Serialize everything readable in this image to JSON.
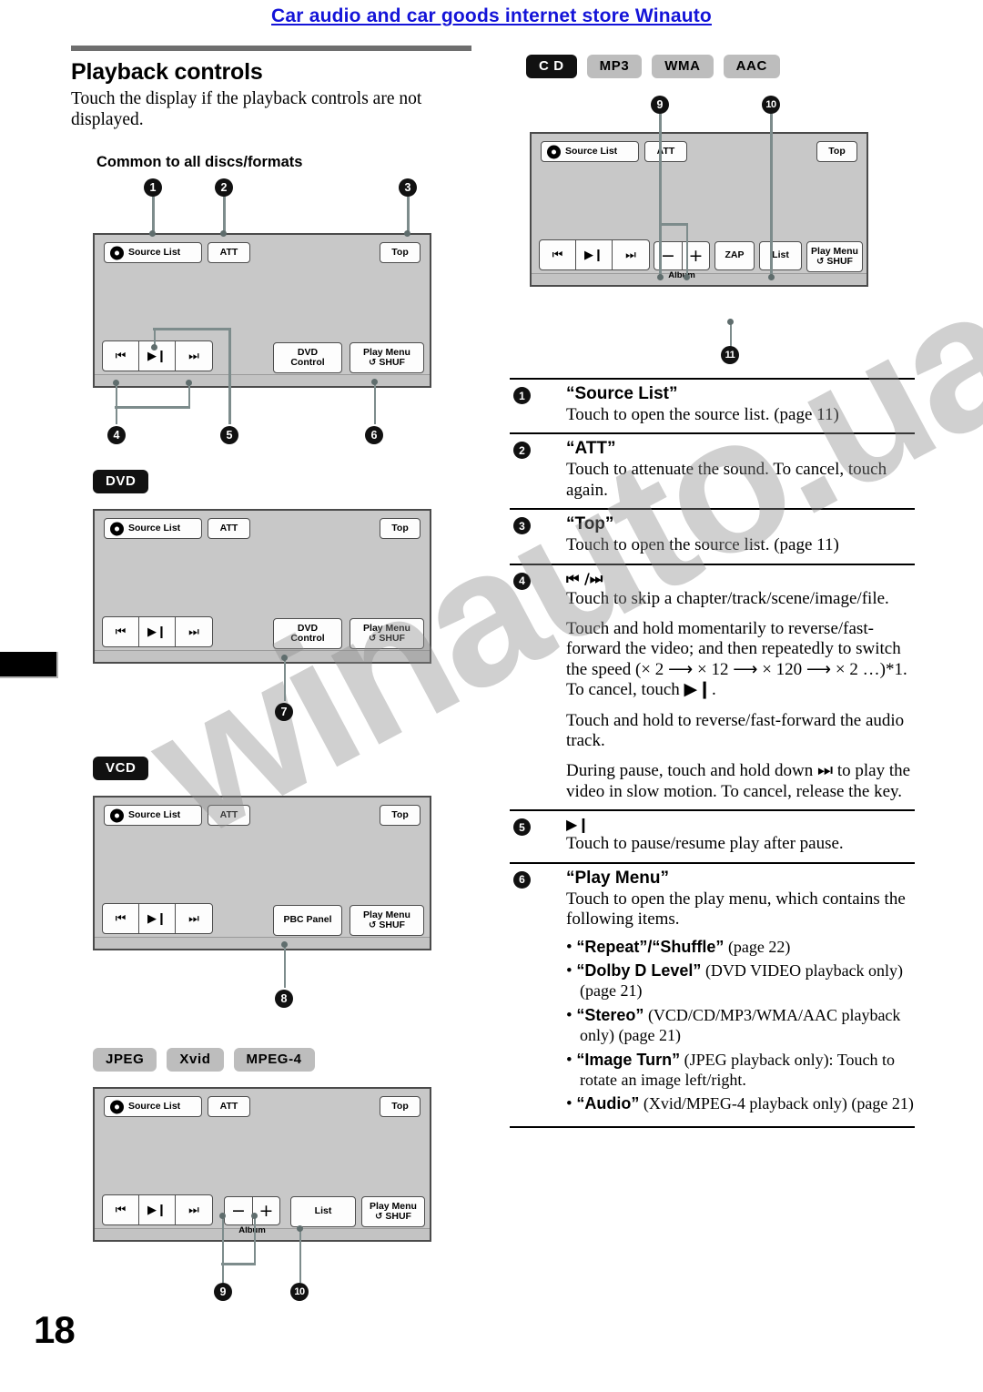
{
  "banner": {
    "text": "Car audio and car goods internet store Winauto"
  },
  "page_number": "18",
  "watermark": "winauto.ua",
  "left": {
    "section_title": "Playback controls",
    "intro": "Touch the display if the playback controls are not displayed.",
    "subhead": "Common to all discs/formats",
    "badges_dvd": [
      "DVD"
    ],
    "badges_vcd": [
      "VCD"
    ],
    "badges_jpeg": [
      "JPEG",
      "Xvid",
      "MPEG-4"
    ]
  },
  "right": {
    "badges_cd": [
      "C D",
      "MP3",
      "WMA",
      "AAC"
    ]
  },
  "panel": {
    "source_list": "Source List",
    "att": "ATT",
    "top": "Top",
    "prev": "⏮",
    "play_pause": "▶❙",
    "next": "⏭",
    "minus": "−",
    "plus": "+",
    "album": "Album",
    "dvd_control_l1": "DVD",
    "dvd_control_l2": "Control",
    "pbc_panel": "PBC Panel",
    "list": "List",
    "zap": "ZAP",
    "play_menu_l1": "Play Menu",
    "play_menu_l2": "SHUF",
    "shuffle_glyph": "↺"
  },
  "callouts": {
    "c1": "1",
    "c2": "2",
    "c3": "3",
    "c4": "4",
    "c5": "5",
    "c6": "6",
    "c7": "7",
    "c8": "8",
    "c9": "9",
    "c10": "10",
    "c11": "11",
    "c9b": "9",
    "c10b": "10"
  },
  "items": [
    {
      "num": "1",
      "title": "“Source List”",
      "paras": [
        "Touch to open the source list. (page 11)"
      ]
    },
    {
      "num": "2",
      "title": "“ATT”",
      "paras": [
        "Touch to attenuate the sound. To cancel, touch again."
      ]
    },
    {
      "num": "3",
      "title": "“Top”",
      "paras": [
        "Touch to open the source list. (page 11)"
      ]
    },
    {
      "num": "4",
      "title_glyph": "⏮ /⏭",
      "paras": [
        "Touch to skip a chapter/track/scene/image/file.",
        "Touch and hold momentarily to reverse/fast-forward the video; and then repeatedly to switch the speed (× 2 ⟶ × 12 ⟶ × 120 ⟶ × 2 …)*1. To cancel, touch ▶❙.",
        "Touch and hold to reverse/fast-forward the audio track.",
        "During pause, touch and hold down ⏭ to play the video in slow motion. To cancel, release the key."
      ]
    },
    {
      "num": "5",
      "title_glyph": "▶❙",
      "paras": [
        "Touch to pause/resume play after pause."
      ]
    },
    {
      "num": "6",
      "title": "“Play Menu”",
      "paras": [
        "Touch to open the play menu, which contains the following items."
      ],
      "bullets": [
        {
          "bold": "“Repeat”/“Shuffle”",
          "rest": " (page 22)"
        },
        {
          "bold": "“Dolby D Level”",
          "rest": " (DVD VIDEO playback only) (page 21)"
        },
        {
          "bold": "“Stereo”",
          "rest": " (VCD/CD/MP3/WMA/AAC playback only) (page 21)"
        },
        {
          "bold": "“Image Turn”",
          "rest": " (JPEG playback only): Touch to rotate an image left/right."
        },
        {
          "bold": "“Audio”",
          "rest": " (Xvid/MPEG-4 playback only) (page 21)"
        }
      ]
    }
  ]
}
